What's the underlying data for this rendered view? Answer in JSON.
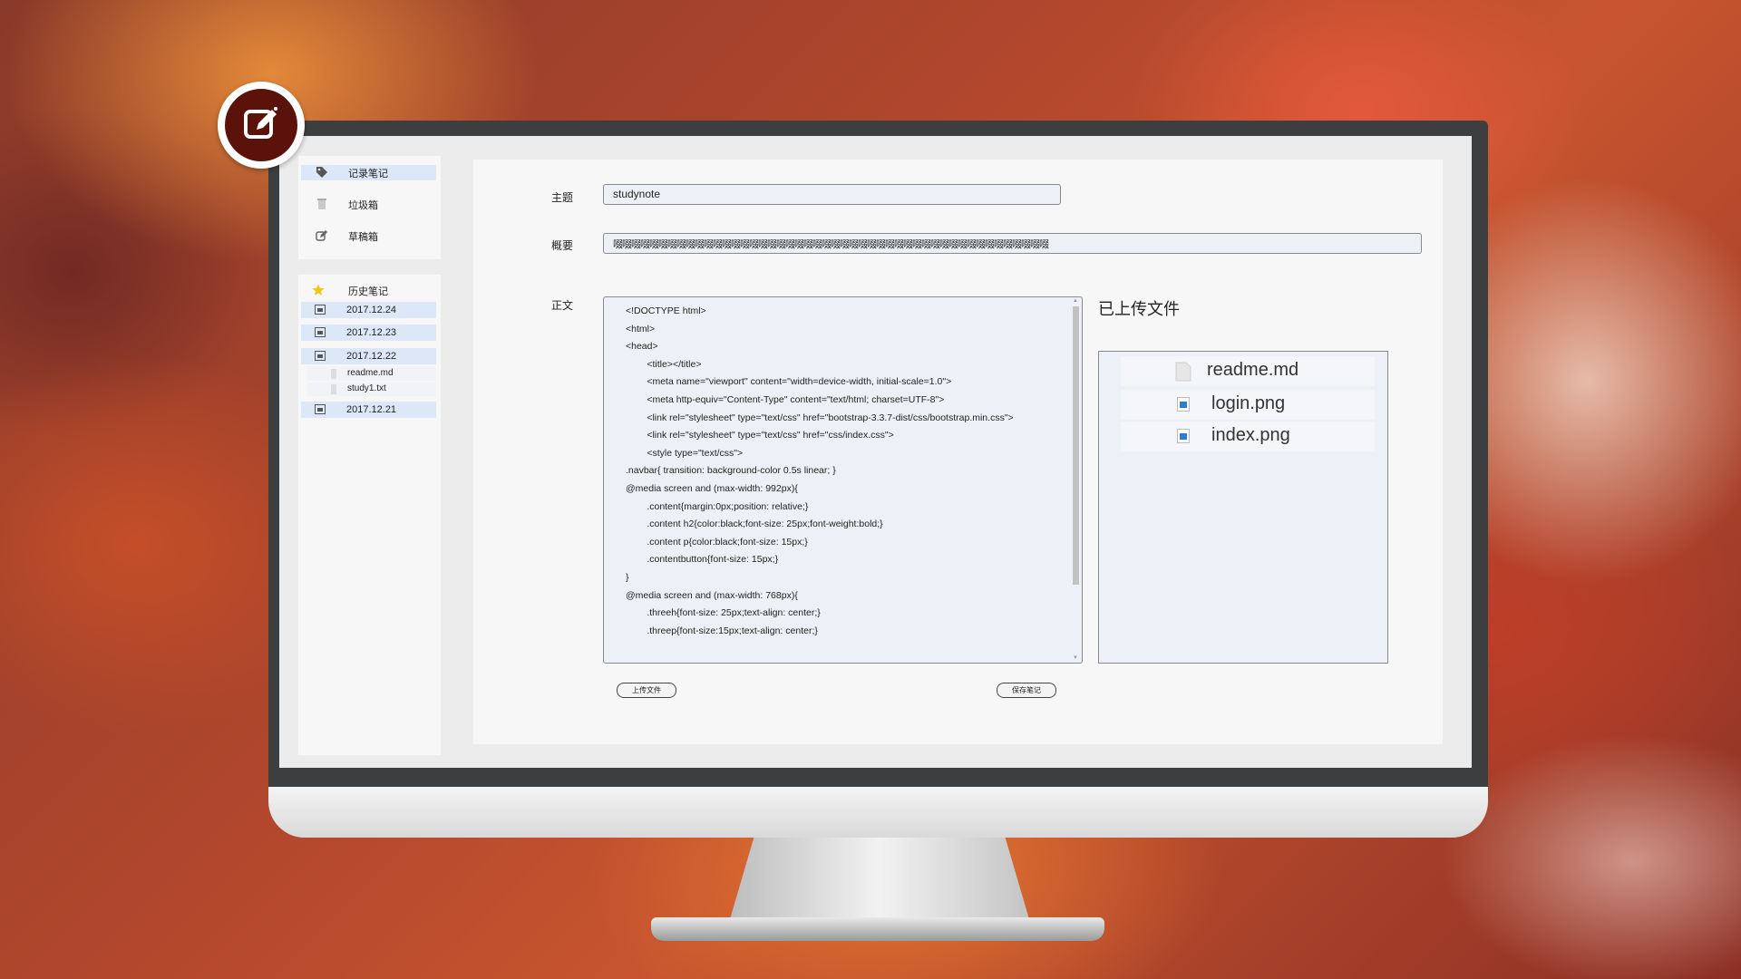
{
  "sidebar": {
    "nav": [
      {
        "label": "记录笔记",
        "icon": "tag-icon"
      },
      {
        "label": "垃圾箱",
        "icon": "trash-icon"
      },
      {
        "label": "草稿箱",
        "icon": "edit-icon"
      }
    ],
    "history": {
      "title": "历史笔记",
      "icon": "star-icon",
      "dates": [
        {
          "label": "2017.12.24"
        },
        {
          "label": "2017.12.23"
        },
        {
          "label": "2017.12.22",
          "files": [
            "readme.md",
            "study1.txt"
          ]
        },
        {
          "label": "2017.12.21"
        }
      ]
    }
  },
  "form": {
    "subject_label": "主题",
    "subject_value": "studynote",
    "summary_label": "概要",
    "summary_value": "啜啜啜啜啜啜啜啜啜啜啜啜啜啜啜啜啜啜啜啜啜啜啜啜啜啜啜啜啜啜啜啜啜啜啜啜啜啜啜啜啜啜啜啜啜啜啜啜",
    "body_label": "正文",
    "code_lines": [
      "<!DOCTYPE html>",
      "<html>",
      "<head>",
      "        <title></title>",
      "        <meta name=\"viewport\" content=\"width=device-width, initial-scale=1.0\">",
      "        <meta http-equiv=\"Content-Type\" content=\"text/html; charset=UTF-8\">",
      "        <link rel=\"stylesheet\" type=\"text/css\" href=\"bootstrap-3.3.7-dist/css/bootstrap.min.css\">",
      "        <link rel=\"stylesheet\" type=\"text/css\" href=\"css/index.css\">",
      "        <style type=\"text/css\">",
      ".navbar{ transition: background-color 0.5s linear; }",
      "@media screen and (max-width: 992px){",
      "        .content{margin:0px;position: relative;}",
      "        .content h2{color:black;font-size: 25px;font-weight:bold;}",
      "        .content p{color:black;font-size: 15px;}",
      "        .contentbutton{font-size: 15px;}",
      "}",
      "@media screen and (max-width: 768px){",
      "        .threeh{font-size: 25px;text-align: center;}",
      "        .threep{font-size:15px;text-align: center;}"
    ]
  },
  "uploaded": {
    "title": "已上传文件",
    "files": [
      {
        "name": "readme.md",
        "icon": "document-icon"
      },
      {
        "name": "login.png",
        "icon": "image-icon"
      },
      {
        "name": "index.png",
        "icon": "image-icon"
      }
    ]
  },
  "buttons": {
    "upload": "上传文件",
    "save": "保存笔记"
  },
  "colors": {
    "logo_bg": "#5a120a",
    "active_item": "#dce8f8",
    "star": "#f5c518"
  }
}
